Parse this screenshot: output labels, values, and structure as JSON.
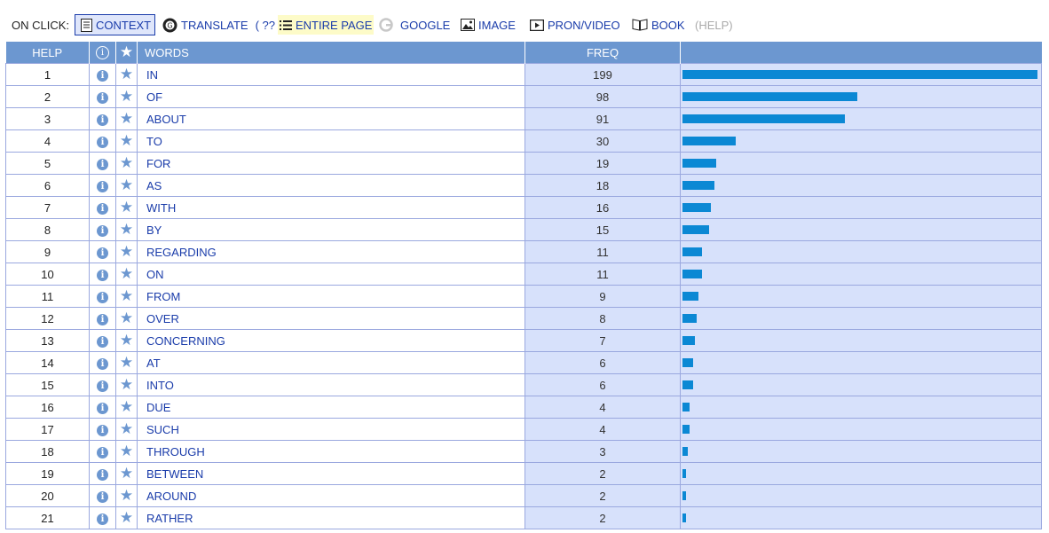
{
  "toolbar": {
    "on_click_label": "ON CLICK:",
    "context_label": "CONTEXT",
    "translate_label": "TRANSLATE",
    "translate_lang": "( ?? )",
    "entire_page_label": "ENTIRE PAGE",
    "google_label": "GOOGLE",
    "image_label": "IMAGE",
    "pron_video_label": "PRON/VIDEO",
    "book_label": "BOOK",
    "help_label": "(HELP)"
  },
  "table": {
    "headers": {
      "help": "HELP",
      "words": "WORDS",
      "freq": "FREQ"
    },
    "max_freq": 199,
    "bar_color": "#0b88d4",
    "rows": [
      {
        "rank": "1",
        "word": "IN",
        "freq": 199
      },
      {
        "rank": "2",
        "word": "OF",
        "freq": 98
      },
      {
        "rank": "3",
        "word": "ABOUT",
        "freq": 91
      },
      {
        "rank": "4",
        "word": "TO",
        "freq": 30
      },
      {
        "rank": "5",
        "word": "FOR",
        "freq": 19
      },
      {
        "rank": "6",
        "word": "AS",
        "freq": 18
      },
      {
        "rank": "7",
        "word": "WITH",
        "freq": 16
      },
      {
        "rank": "8",
        "word": "BY",
        "freq": 15
      },
      {
        "rank": "9",
        "word": "REGARDING",
        "freq": 11
      },
      {
        "rank": "10",
        "word": "ON",
        "freq": 11
      },
      {
        "rank": "11",
        "word": "FROM",
        "freq": 9
      },
      {
        "rank": "12",
        "word": "OVER",
        "freq": 8
      },
      {
        "rank": "13",
        "word": "CONCERNING",
        "freq": 7
      },
      {
        "rank": "14",
        "word": "AT",
        "freq": 6
      },
      {
        "rank": "15",
        "word": "INTO",
        "freq": 6
      },
      {
        "rank": "16",
        "word": "DUE",
        "freq": 4
      },
      {
        "rank": "17",
        "word": "SUCH",
        "freq": 4
      },
      {
        "rank": "18",
        "word": "THROUGH",
        "freq": 3
      },
      {
        "rank": "19",
        "word": "BETWEEN",
        "freq": 2
      },
      {
        "rank": "20",
        "word": "AROUND",
        "freq": 2
      },
      {
        "rank": "21",
        "word": "RATHER",
        "freq": 2
      }
    ]
  }
}
